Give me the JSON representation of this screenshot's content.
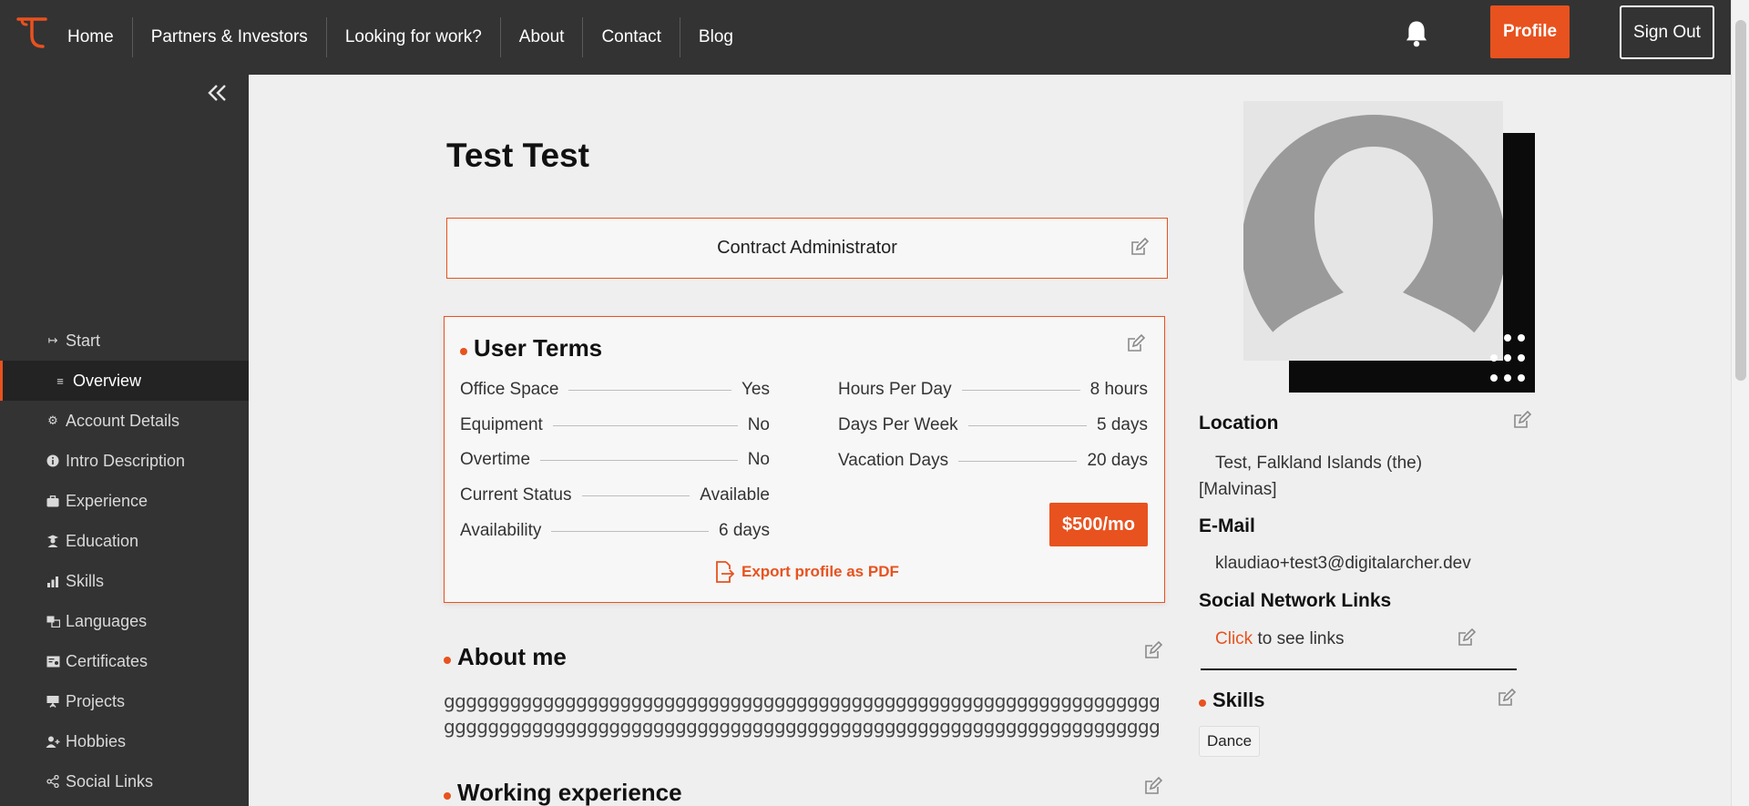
{
  "nav": {
    "items": [
      "Home",
      "Partners & Investors",
      "Looking for work?",
      "About",
      "Contact",
      "Blog"
    ],
    "profile_label": "Profile",
    "signout_label": "Sign Out"
  },
  "sidebar": {
    "items": [
      {
        "label": "Start",
        "icon": "arrow-right-to-bar-icon"
      },
      {
        "label": "Overview",
        "icon": "list-icon",
        "active": true
      },
      {
        "label": "Account Details",
        "icon": "gear-icon"
      },
      {
        "label": "Intro Description",
        "icon": "info-icon"
      },
      {
        "label": "Experience",
        "icon": "briefcase-icon"
      },
      {
        "label": "Education",
        "icon": "graduate-icon"
      },
      {
        "label": "Skills",
        "icon": "bar-chart-icon"
      },
      {
        "label": "Languages",
        "icon": "translate-icon"
      },
      {
        "label": "Certificates",
        "icon": "certificate-icon"
      },
      {
        "label": "Projects",
        "icon": "presentation-icon"
      },
      {
        "label": "Hobbies",
        "icon": "user-plus-icon"
      },
      {
        "label": "Social Links",
        "icon": "share-icon"
      }
    ]
  },
  "profile": {
    "name": "Test Test",
    "job_title": "Contract Administrator"
  },
  "user_terms": {
    "heading": "User Terms",
    "left": [
      {
        "label": "Office Space",
        "value": "Yes"
      },
      {
        "label": "Equipment",
        "value": "No"
      },
      {
        "label": "Overtime",
        "value": "No"
      },
      {
        "label": "Current Status",
        "value": "Available"
      },
      {
        "label": "Availability",
        "value": "6 days"
      }
    ],
    "right": [
      {
        "label": "Hours Per Day",
        "value": "8 hours"
      },
      {
        "label": "Days Per Week",
        "value": "5 days"
      },
      {
        "label": "Vacation Days",
        "value": "20 days"
      }
    ],
    "price": "$500/mo",
    "export_label": "Export profile as PDF"
  },
  "about": {
    "heading": "About me",
    "text": "gggggggggggggggggggggggggggggggggggggggggggggggggggggggggggggggggggggggggggggggggggggggggggggggggggggggggggggggggggggggggggggggggg"
  },
  "working_experience": {
    "heading": "Working experience"
  },
  "right": {
    "location_label": "Location",
    "location_value": "Test, Falkland Islands (the) [Malvinas]",
    "email_label": "E-Mail",
    "email_value": "klaudiao+test3@digitalarcher.dev",
    "social_label": "Social Network Links",
    "social_click": "Click",
    "social_rest": " to see links",
    "skills_heading": "Skills",
    "skills": [
      "Dance"
    ]
  },
  "colors": {
    "accent": "#e8521f",
    "dark": "#333333"
  }
}
